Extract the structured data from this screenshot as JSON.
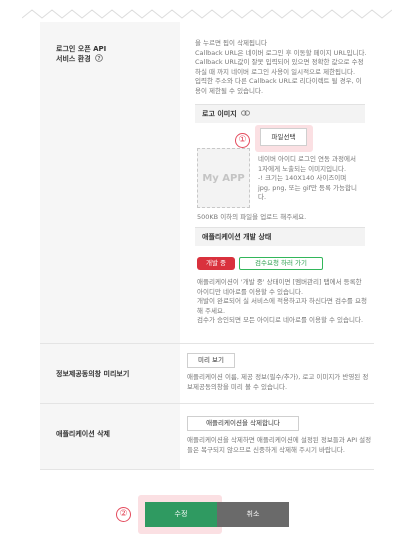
{
  "callback_section": {
    "label_line1": "로그인 오픈 API",
    "label_line2": "서비스 환경",
    "help_icon": "question-circle-icon",
    "desc": [
      "을 누르면 됩이 삭제됩니다",
      "Callback URL은 네이버 로그인 후 이동할 페이지 URL입니다.",
      "Callback URL값이 잘못 입력되어 있으면 정확한 값으로 수정",
      "하실 때 까지 네이버 로그인 사용이 일시적으로 제한됩니다.",
      "입력한 주소와 다른 Callback URL로 리다이렉트 될 경우, 이",
      "용이 제한될 수 있습니다."
    ]
  },
  "logo_section": {
    "title": "로고 이미지",
    "link_icon": "link-icon",
    "file_button": "파일선택",
    "placeholder": "My APP",
    "desc": [
      "네이버 아이디 로그인 연동 과정에서",
      "1자에게 노출되는 이미지입니다.",
      "-! 크기는 140X140 사이즈이며",
      "jpg, png, 또는 gif만 등록 가능합니",
      "다."
    ],
    "size_note": "500KB 이하의 파일을 업로드 해주세요."
  },
  "status_section": {
    "title": "애플리케이션 개발 상태",
    "status_badge": "개발 중",
    "review_button": "검수요청 하러 가기",
    "desc": [
      "애플리케이션이 '개발 중' 상태이면 [멤버관리] 탭에서 등록한",
      "아이디만 네아로를 이용할 수 있습니다.",
      "개발이 완료되어 실 서비스에 적용하고자 하신다면 검수를 요청",
      "해 주세요.",
      "검수가 승인되면 모든 아이디로 네아로를 이용할 수 있습니다."
    ]
  },
  "preview_section": {
    "label": "정보제공동의창 미리보기",
    "button": "미리 보기",
    "desc": [
      "애플리케이션 이름, 제공 정보(필수/추가), 로고 이미지가 반영된 정",
      "보제공동의창을 미리 볼 수 있습니다."
    ]
  },
  "delete_section": {
    "label": "애플리케이션 삭제",
    "button": "애플리케이션을 삭제합니다",
    "desc": [
      "애플리케이션을 삭제하면 애플리케이션에 설정된 정보들과 API 설정",
      "들은 복구되지 않으므로 신중하게 삭제해 주시기 바랍니다."
    ]
  },
  "markers": {
    "one": "①",
    "two": "②"
  },
  "footer": {
    "submit": "수정",
    "cancel": "취소"
  },
  "colors": {
    "accent_green": "#2f9a61",
    "status_red": "#d9313d",
    "marker_pink": "#e44b5d"
  }
}
